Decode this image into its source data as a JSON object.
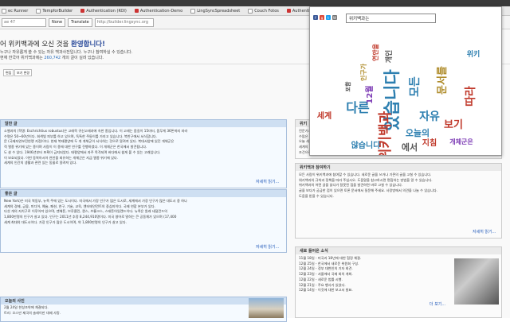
{
  "browser": {
    "bookmarks": [
      "ec Runner",
      "TempforBuilder",
      "Authentication (KOI)",
      "Authentication-Demo",
      "LingSyncSpreadsheet",
      "Couch Fotos",
      "Authentication"
    ],
    "translate_bar": {
      "lang_value": "ae 47",
      "none_button": "None",
      "translate_button": "Translate",
      "url": "http://builder.lingsync.org"
    }
  },
  "page": {
    "welcome_prefix": "어 위키백과에 오신 것을",
    "welcome_bold": "환영합니다!",
    "welcome_line2": "누구나 자유롭게 쓸 수 있는 자유 백과사전입니다. 누구나 참여하실 수 있습니다.",
    "welcome_line3": "현재 한국어 위키백과에는",
    "article_count": "260,742",
    "welcome_line3_suffix": "개의 글이 실려 있습니다.",
    "small_buttons": [
      "편집",
      "보기 변경"
    ]
  },
  "boxes": {
    "featured": {
      "title": "알찬 글",
      "lines": [
        "소벨과의 (학명: Eschrichtius robustus)은 고래목 귀신고래과에 속한 종입니다. 이 고래는 몸길이 15미터, 몸무게 36톤까지 자라",
        "수명은 50~60년이다. 회색빛 피부를 하고 있으며, 독특한 주둥이를 가지고 있습니다. 북반구에서 서식합니다.",
        "문 (국제자연보전연맹 지정)이다. 현재 북태평양에 두 개 개체군이 서식하는 것으로 알려져 있다. 북대서양에 있던 개체군은",
        "적 멸종 위기에 있는 종이며 사람이 이 종에 대한 연구를 진행하였다. 이 개체군은 한국에서 발견됩니다.",
        "도 살 수 있다. 1946년부터 포획이 금지되었다. 태평양에서 자주 목격되며 바다에서 쉽게 볼 수 있는 고래입니다.",
        "이 보호되었다. 이번 동북아시아 연안을 회유하는 개체군은 지금 멸종 위기에 있다.",
        "세계의 인간의 생활과 관련 있는 동물로 알려져 있다."
      ],
      "more": "자세히 읽기..."
    },
    "good": {
      "title": "좋은 글",
      "lines": [
        "New York)은 미국 북동부, 뉴욕 주에 있는 도시이다. 미국에서 가장 인구가 많은 도시로, 세계에서 가장 인구가 많은 대도시 중 하나",
        "세계의 경제, 금융, 미디어, 예술, 패션, 연구, 기술, 교육, 엔터테인먼트의 중심지이다. 국제 연합 본부가 있다.",
        "다섯 개의 자치구로 이루어져 있으며, 맨해튼, 브루클린, 퀸스, 브롱크스, 스태튼아일랜드이다. 뉴욕은 원래 네덜란드의",
        "1,800만명의 인구가 살고 있다. 인구는 2011년 추정 8,244,910명이다. 미국 영어로 말하는 큰 공동체가 있으며 (17,400",
        "세계 최대의 대도시이다. 가장 인구가 많은 도시이며, 약 1,800만명의 인구가 살고 있다."
      ],
      "more": "자세히 읽기..."
    },
    "today": {
      "title": "오늘의 사진",
      "lines": [
        "2월 24일 한성조약에 체결되다.",
        "트리: 오스만 제국의 술레이만 대제 사망."
      ]
    },
    "participate": {
      "title": "위키백과 참여하기",
      "lines": [
        "모든 사람이 위키백과에 참여할 수 있습니다. 새로운 글을 쓰거나 기존의 글을 고칠 수 있습니다.",
        "위키백과의 규칙과 정책을 따라 주십시오. 도움말을 참고하시면 편집하는 방법을 알 수 있습니다.",
        "위키백과의 어떤 글을 읽다가 잘못된 점을 발견하면 바로 고칠 수 있습니다.",
        "글을 보다가 궁금한 점이 있으면 토론 문서에서 질문해 주세요. 사랑방에서 의견을 나눌 수 있습니다.",
        "도움을 받을 수 있습니다."
      ],
      "more": "자세히 읽기..."
    },
    "news": {
      "title": "새로 들어온 소식",
      "lines": [
        "11월 18일 - 미국과 18년에 대한 협정 체결.",
        "12월 25일 - 한국에서 새로운 위원회 구성.",
        "12월 24일 - 정부 대변인의 기자 회견.",
        "12월 23일 - 서울에서 국제 회의 개최.",
        "12월 22일 - 새로운 법률 시행.",
        "12월 21일 - 주요 행사가 있었다.",
        "12월 14일 - 이것에 대한 보고서 발표."
      ],
      "more": "더 보기..."
    },
    "right_top": {
      "title": "위키",
      "lines": [
        "전문가가 아닌 일반 독자를 위한",
        "수많은 글이 있습니다.",
        "오늘 새롭게 만들어진 글을 보세요.",
        "세계의 다양한 주제를 다루는",
        "조건으로 3.0에 따라 사용할 수 있습니다."
      ]
    }
  },
  "popup": {
    "search_value": "위키백과는",
    "words": [
      {
        "t": "있습니다",
        "c": "#2d7fb0",
        "s": 21
      },
      {
        "t": "위키백과",
        "c": "#c0392b",
        "s": 17
      },
      {
        "t": "다른",
        "c": "#2d7fb0",
        "s": 16
      },
      {
        "t": "문서를",
        "c": "#b08d2d",
        "s": 13
      },
      {
        "t": "자유",
        "c": "#2d7fb0",
        "s": 14
      },
      {
        "t": "보기",
        "c": "#c0392b",
        "s": 13
      },
      {
        "t": "세계",
        "c": "#c0392b",
        "s": 10
      },
      {
        "t": "12월",
        "c": "#7d3cb5",
        "s": 10
      },
      {
        "t": "오늘의",
        "c": "#2d7fb0",
        "s": 11
      },
      {
        "t": "개인",
        "c": "#555555",
        "s": 9
      },
      {
        "t": "모든",
        "c": "#2d7fb0",
        "s": 14
      },
      {
        "t": "따라",
        "c": "#c0392b",
        "s": 14
      },
      {
        "t": "않습니다",
        "c": "#2d7fb0",
        "s": 10
      },
      {
        "t": "에서",
        "c": "#555555",
        "s": 11
      },
      {
        "t": "지침",
        "c": "#c0392b",
        "s": 10
      },
      {
        "t": "개체군은",
        "c": "#7d3cb5",
        "s": 8
      },
      {
        "t": "인구가",
        "c": "#b08d2d",
        "s": 8
      },
      {
        "t": "연안을",
        "c": "#c0392b",
        "s": 8
      },
      {
        "t": "포함",
        "c": "#555555",
        "s": 7
      },
      {
        "t": "위키",
        "c": "#2d7fb0",
        "s": 9
      }
    ]
  }
}
